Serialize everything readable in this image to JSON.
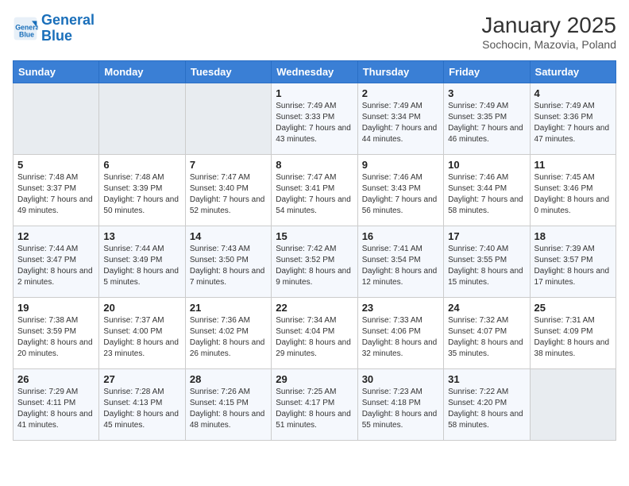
{
  "header": {
    "logo_line1": "General",
    "logo_line2": "Blue",
    "title": "January 2025",
    "subtitle": "Sochocin, Mazovia, Poland"
  },
  "weekdays": [
    "Sunday",
    "Monday",
    "Tuesday",
    "Wednesday",
    "Thursday",
    "Friday",
    "Saturday"
  ],
  "weeks": [
    [
      {
        "day": "",
        "info": ""
      },
      {
        "day": "",
        "info": ""
      },
      {
        "day": "",
        "info": ""
      },
      {
        "day": "1",
        "info": "Sunrise: 7:49 AM\nSunset: 3:33 PM\nDaylight: 7 hours\nand 43 minutes."
      },
      {
        "day": "2",
        "info": "Sunrise: 7:49 AM\nSunset: 3:34 PM\nDaylight: 7 hours\nand 44 minutes."
      },
      {
        "day": "3",
        "info": "Sunrise: 7:49 AM\nSunset: 3:35 PM\nDaylight: 7 hours\nand 46 minutes."
      },
      {
        "day": "4",
        "info": "Sunrise: 7:49 AM\nSunset: 3:36 PM\nDaylight: 7 hours\nand 47 minutes."
      }
    ],
    [
      {
        "day": "5",
        "info": "Sunrise: 7:48 AM\nSunset: 3:37 PM\nDaylight: 7 hours\nand 49 minutes."
      },
      {
        "day": "6",
        "info": "Sunrise: 7:48 AM\nSunset: 3:39 PM\nDaylight: 7 hours\nand 50 minutes."
      },
      {
        "day": "7",
        "info": "Sunrise: 7:47 AM\nSunset: 3:40 PM\nDaylight: 7 hours\nand 52 minutes."
      },
      {
        "day": "8",
        "info": "Sunrise: 7:47 AM\nSunset: 3:41 PM\nDaylight: 7 hours\nand 54 minutes."
      },
      {
        "day": "9",
        "info": "Sunrise: 7:46 AM\nSunset: 3:43 PM\nDaylight: 7 hours\nand 56 minutes."
      },
      {
        "day": "10",
        "info": "Sunrise: 7:46 AM\nSunset: 3:44 PM\nDaylight: 7 hours\nand 58 minutes."
      },
      {
        "day": "11",
        "info": "Sunrise: 7:45 AM\nSunset: 3:46 PM\nDaylight: 8 hours\nand 0 minutes."
      }
    ],
    [
      {
        "day": "12",
        "info": "Sunrise: 7:44 AM\nSunset: 3:47 PM\nDaylight: 8 hours\nand 2 minutes."
      },
      {
        "day": "13",
        "info": "Sunrise: 7:44 AM\nSunset: 3:49 PM\nDaylight: 8 hours\nand 5 minutes."
      },
      {
        "day": "14",
        "info": "Sunrise: 7:43 AM\nSunset: 3:50 PM\nDaylight: 8 hours\nand 7 minutes."
      },
      {
        "day": "15",
        "info": "Sunrise: 7:42 AM\nSunset: 3:52 PM\nDaylight: 8 hours\nand 9 minutes."
      },
      {
        "day": "16",
        "info": "Sunrise: 7:41 AM\nSunset: 3:54 PM\nDaylight: 8 hours\nand 12 minutes."
      },
      {
        "day": "17",
        "info": "Sunrise: 7:40 AM\nSunset: 3:55 PM\nDaylight: 8 hours\nand 15 minutes."
      },
      {
        "day": "18",
        "info": "Sunrise: 7:39 AM\nSunset: 3:57 PM\nDaylight: 8 hours\nand 17 minutes."
      }
    ],
    [
      {
        "day": "19",
        "info": "Sunrise: 7:38 AM\nSunset: 3:59 PM\nDaylight: 8 hours\nand 20 minutes."
      },
      {
        "day": "20",
        "info": "Sunrise: 7:37 AM\nSunset: 4:00 PM\nDaylight: 8 hours\nand 23 minutes."
      },
      {
        "day": "21",
        "info": "Sunrise: 7:36 AM\nSunset: 4:02 PM\nDaylight: 8 hours\nand 26 minutes."
      },
      {
        "day": "22",
        "info": "Sunrise: 7:34 AM\nSunset: 4:04 PM\nDaylight: 8 hours\nand 29 minutes."
      },
      {
        "day": "23",
        "info": "Sunrise: 7:33 AM\nSunset: 4:06 PM\nDaylight: 8 hours\nand 32 minutes."
      },
      {
        "day": "24",
        "info": "Sunrise: 7:32 AM\nSunset: 4:07 PM\nDaylight: 8 hours\nand 35 minutes."
      },
      {
        "day": "25",
        "info": "Sunrise: 7:31 AM\nSunset: 4:09 PM\nDaylight: 8 hours\nand 38 minutes."
      }
    ],
    [
      {
        "day": "26",
        "info": "Sunrise: 7:29 AM\nSunset: 4:11 PM\nDaylight: 8 hours\nand 41 minutes."
      },
      {
        "day": "27",
        "info": "Sunrise: 7:28 AM\nSunset: 4:13 PM\nDaylight: 8 hours\nand 45 minutes."
      },
      {
        "day": "28",
        "info": "Sunrise: 7:26 AM\nSunset: 4:15 PM\nDaylight: 8 hours\nand 48 minutes."
      },
      {
        "day": "29",
        "info": "Sunrise: 7:25 AM\nSunset: 4:17 PM\nDaylight: 8 hours\nand 51 minutes."
      },
      {
        "day": "30",
        "info": "Sunrise: 7:23 AM\nSunset: 4:18 PM\nDaylight: 8 hours\nand 55 minutes."
      },
      {
        "day": "31",
        "info": "Sunrise: 7:22 AM\nSunset: 4:20 PM\nDaylight: 8 hours\nand 58 minutes."
      },
      {
        "day": "",
        "info": ""
      }
    ]
  ]
}
